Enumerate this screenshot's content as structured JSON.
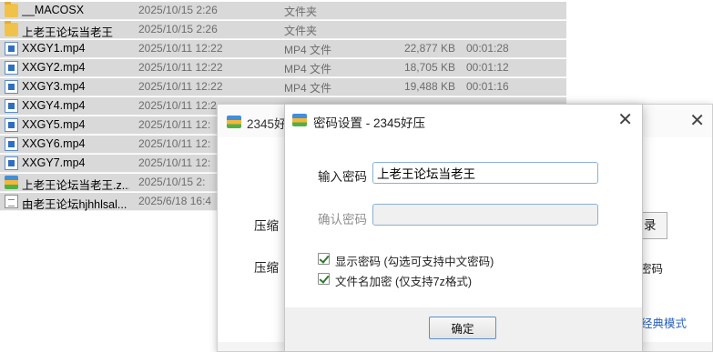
{
  "explorer": {
    "files": [
      {
        "icon": "folder-icon",
        "name": "__MACOSX",
        "date": "2025/10/15 2:26",
        "type": "文件夹",
        "size": "",
        "duration": ""
      },
      {
        "icon": "folder-icon",
        "name": "上老王论坛当老王",
        "date": "2025/10/15 2:26",
        "type": "文件夹",
        "size": "",
        "duration": ""
      },
      {
        "icon": "video-file-icon",
        "name": "XXGY1.mp4",
        "date": "2025/10/11 12:22",
        "type": "MP4 文件",
        "size": "22,877 KB",
        "duration": "00:01:28"
      },
      {
        "icon": "video-file-icon",
        "name": "XXGY2.mp4",
        "date": "2025/10/11 12:22",
        "type": "MP4 文件",
        "size": "18,705 KB",
        "duration": "00:01:12"
      },
      {
        "icon": "video-file-icon",
        "name": "XXGY3.mp4",
        "date": "2025/10/11 12:22",
        "type": "MP4 文件",
        "size": "19,488 KB",
        "duration": "00:01:16"
      },
      {
        "icon": "video-file-icon",
        "name": "XXGY4.mp4",
        "date": "2025/10/11 12:2",
        "type": "",
        "size": "",
        "duration": ""
      },
      {
        "icon": "video-file-icon",
        "name": "XXGY5.mp4",
        "date": "2025/10/11 12:",
        "type": "",
        "size": "",
        "duration": ""
      },
      {
        "icon": "video-file-icon",
        "name": "XXGY6.mp4",
        "date": "2025/10/11 12:",
        "type": "",
        "size": "",
        "duration": ""
      },
      {
        "icon": "video-file-icon",
        "name": "XXGY7.mp4",
        "date": "2025/10/11 12:",
        "type": "",
        "size": "",
        "duration": ""
      },
      {
        "icon": "zip-archive-icon",
        "name": "上老王论坛当老王.z...",
        "date": "2025/10/15 2:",
        "type": "",
        "size": "",
        "duration": ""
      },
      {
        "icon": "text-file-icon",
        "name": "由老王论坛hjhhlsal...",
        "date": "2025/6/18 16:4",
        "type": "",
        "size": "",
        "duration": ""
      }
    ]
  },
  "back_window": {
    "title": "2345好",
    "label_1": "压缩",
    "label_2": "压缩",
    "browse_fragment": "录",
    "right_fragment": "密码",
    "mode_link": "经典模式",
    "close_glyph": "✕"
  },
  "password_dialog": {
    "title": "密码设置 - 2345好压",
    "close_glyph": "✕",
    "password_label": "输入密码",
    "password_value": "上老王论坛当老王",
    "confirm_label": "确认密码",
    "confirm_value": "",
    "show_password_label": "显示密码 (勾选可支持中文密码)",
    "show_password_checked": true,
    "encrypt_filenames_label": "文件名加密 (仅支持7z格式)",
    "encrypt_filenames_checked": true,
    "ok_label": "确定"
  },
  "colors": {
    "selected_row_bg": "#d9d9d9",
    "link_blue": "#2a62b8",
    "input_border": "#8ab0d8"
  }
}
